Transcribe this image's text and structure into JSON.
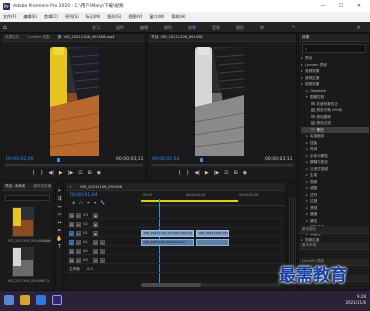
{
  "window": {
    "title": "Adobe Premiere Pro 2020 - C:\\用户\\Mary\\下载\\视频",
    "controls": [
      "—",
      "☐",
      "✕"
    ]
  },
  "menu": [
    "文件(F)",
    "编辑(E)",
    "剪辑(C)",
    "序列(S)",
    "标记(M)",
    "图形(G)",
    "视图(V)",
    "窗口(W)",
    "帮助(H)"
  ],
  "workspace": {
    "tabs": [
      "学习",
      "组件",
      "编辑",
      "颜色",
      "效果",
      "音频",
      "图形",
      "库"
    ],
    "active": "效果",
    "more": "»"
  },
  "source_monitor": {
    "tabs": [
      "效果控件",
      "Lumetri 范围",
      "源: VID_20211106_091406.mp4"
    ],
    "timecode_current": "00;00;02;00",
    "timecode_duration": "00;00;03;11"
  },
  "program_monitor": {
    "tabs": [
      "节目: VID_20211106_091406"
    ],
    "timecode_current": "00;00;01;04",
    "timecode_duration": "00;00;03;11"
  },
  "effects_panel": {
    "title": "效果",
    "items": [
      {
        "label": "预设",
        "level": 0,
        "kind": "folder"
      },
      {
        "label": "Lumetri 预设",
        "level": 0,
        "kind": "folder"
      },
      {
        "label": "音频效果",
        "level": 0,
        "kind": "folder"
      },
      {
        "label": "音频过渡",
        "level": 0,
        "kind": "folder"
      },
      {
        "label": "视频效果",
        "level": 0,
        "kind": "folder"
      },
      {
        "label": "Obsolete",
        "level": 1,
        "kind": "folder"
      },
      {
        "label": "图像控制",
        "level": 1,
        "kind": "folder",
        "open": true
      },
      {
        "label": "灰度系数校正",
        "level": 2,
        "kind": "fx"
      },
      {
        "label": "颜色平衡 (RGB)",
        "level": 2,
        "kind": "fx"
      },
      {
        "label": "颜色替换",
        "level": 2,
        "kind": "fx"
      },
      {
        "label": "颜色过滤",
        "level": 2,
        "kind": "fx"
      },
      {
        "label": "黑白",
        "level": 2,
        "kind": "fx",
        "selected": true
      },
      {
        "label": "实用程序",
        "level": 1,
        "kind": "folder"
      },
      {
        "label": "扭曲",
        "level": 1,
        "kind": "folder"
      },
      {
        "label": "时间",
        "level": 1,
        "kind": "folder"
      },
      {
        "label": "杂色与颗粒",
        "level": 1,
        "kind": "folder"
      },
      {
        "label": "模糊与锐化",
        "level": 1,
        "kind": "folder"
      },
      {
        "label": "沉浸式视频",
        "level": 1,
        "kind": "folder"
      },
      {
        "label": "生成",
        "level": 1,
        "kind": "folder"
      },
      {
        "label": "视频",
        "level": 1,
        "kind": "folder"
      },
      {
        "label": "调整",
        "level": 1,
        "kind": "folder"
      },
      {
        "label": "过时",
        "level": 1,
        "kind": "folder"
      },
      {
        "label": "过渡",
        "level": 1,
        "kind": "folder"
      },
      {
        "label": "透视",
        "level": 1,
        "kind": "folder"
      },
      {
        "label": "通道",
        "level": 1,
        "kind": "folder"
      },
      {
        "label": "键控",
        "level": 1,
        "kind": "folder"
      },
      {
        "label": "颜色校正",
        "level": 1,
        "kind": "folder"
      },
      {
        "label": "风格化",
        "level": 1,
        "kind": "folder"
      },
      {
        "label": "视频过渡",
        "level": 0,
        "kind": "folder"
      }
    ],
    "subpanels": [
      "基本图形",
      "基本声音",
      "Lumetri 颜色",
      "库"
    ]
  },
  "project_panel": {
    "tabs": [
      "项目: 未命名",
      "媒体浏览器"
    ],
    "search_placeholder": "",
    "items": [
      {
        "name": "VID_2021106_091406.mp4",
        "duration": "3;11"
      },
      {
        "name": "VID_2021106_091406",
        "duration": "3;11"
      }
    ]
  },
  "timeline": {
    "tab": "VID_20211106_091406",
    "timecode": "00;00;01;04",
    "ruler": [
      "00;00",
      "00;00;01;00",
      "00;00;02;00"
    ],
    "tracks": [
      {
        "label": "V3"
      },
      {
        "label": "V2"
      },
      {
        "label": "V1"
      },
      {
        "label": "A1"
      },
      {
        "label": "A2"
      },
      {
        "label": "A3"
      }
    ],
    "master": "主声道",
    "master_value": "0.0",
    "clips": {
      "v1": [
        {
          "name": "VID_20211106_091406.mp4 [V]"
        },
        {
          "name": "VID_20211106_091406.mp4"
        }
      ],
      "a1": [
        {
          "name": "VID_2021106_091406.mp4"
        },
        {
          "name": ""
        }
      ]
    }
  },
  "taskbar": {
    "time": "9:28",
    "date": "2021/11/6"
  },
  "watermark": "最需教育",
  "colors": {
    "accent": "#2f8ffa",
    "clip_video": "#7e9ec8",
    "clip_audio": "#5d7ea8"
  }
}
